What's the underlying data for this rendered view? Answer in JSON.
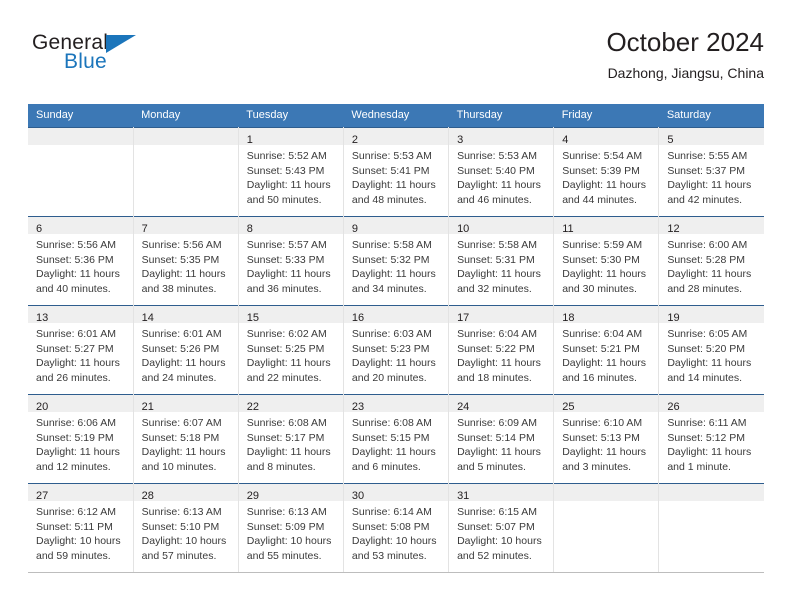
{
  "logo": {
    "word_top": "General",
    "word_bottom": "Blue",
    "accent_color": "#1b75bb",
    "triangle_icon": "triangle-right-icon"
  },
  "header": {
    "title": "October 2024",
    "subtitle": "Dazhong, Jiangsu, China"
  },
  "theme": {
    "header_blue": "#3c78b5",
    "row_divider": "#2e5d8e",
    "daynum_band": "#efefef",
    "text": "#231f20"
  },
  "calendar": {
    "weekday_headers": [
      "Sunday",
      "Monday",
      "Tuesday",
      "Wednesday",
      "Thursday",
      "Friday",
      "Saturday"
    ],
    "weeks": [
      [
        {
          "day": "",
          "lines": [
            "",
            "",
            "",
            ""
          ]
        },
        {
          "day": "",
          "lines": [
            "",
            "",
            "",
            ""
          ]
        },
        {
          "day": "1",
          "lines": [
            "Sunrise: 5:52 AM",
            "Sunset: 5:43 PM",
            "Daylight: 11 hours",
            "and 50 minutes."
          ]
        },
        {
          "day": "2",
          "lines": [
            "Sunrise: 5:53 AM",
            "Sunset: 5:41 PM",
            "Daylight: 11 hours",
            "and 48 minutes."
          ]
        },
        {
          "day": "3",
          "lines": [
            "Sunrise: 5:53 AM",
            "Sunset: 5:40 PM",
            "Daylight: 11 hours",
            "and 46 minutes."
          ]
        },
        {
          "day": "4",
          "lines": [
            "Sunrise: 5:54 AM",
            "Sunset: 5:39 PM",
            "Daylight: 11 hours",
            "and 44 minutes."
          ]
        },
        {
          "day": "5",
          "lines": [
            "Sunrise: 5:55 AM",
            "Sunset: 5:37 PM",
            "Daylight: 11 hours",
            "and 42 minutes."
          ]
        }
      ],
      [
        {
          "day": "6",
          "lines": [
            "Sunrise: 5:56 AM",
            "Sunset: 5:36 PM",
            "Daylight: 11 hours",
            "and 40 minutes."
          ]
        },
        {
          "day": "7",
          "lines": [
            "Sunrise: 5:56 AM",
            "Sunset: 5:35 PM",
            "Daylight: 11 hours",
            "and 38 minutes."
          ]
        },
        {
          "day": "8",
          "lines": [
            "Sunrise: 5:57 AM",
            "Sunset: 5:33 PM",
            "Daylight: 11 hours",
            "and 36 minutes."
          ]
        },
        {
          "day": "9",
          "lines": [
            "Sunrise: 5:58 AM",
            "Sunset: 5:32 PM",
            "Daylight: 11 hours",
            "and 34 minutes."
          ]
        },
        {
          "day": "10",
          "lines": [
            "Sunrise: 5:58 AM",
            "Sunset: 5:31 PM",
            "Daylight: 11 hours",
            "and 32 minutes."
          ]
        },
        {
          "day": "11",
          "lines": [
            "Sunrise: 5:59 AM",
            "Sunset: 5:30 PM",
            "Daylight: 11 hours",
            "and 30 minutes."
          ]
        },
        {
          "day": "12",
          "lines": [
            "Sunrise: 6:00 AM",
            "Sunset: 5:28 PM",
            "Daylight: 11 hours",
            "and 28 minutes."
          ]
        }
      ],
      [
        {
          "day": "13",
          "lines": [
            "Sunrise: 6:01 AM",
            "Sunset: 5:27 PM",
            "Daylight: 11 hours",
            "and 26 minutes."
          ]
        },
        {
          "day": "14",
          "lines": [
            "Sunrise: 6:01 AM",
            "Sunset: 5:26 PM",
            "Daylight: 11 hours",
            "and 24 minutes."
          ]
        },
        {
          "day": "15",
          "lines": [
            "Sunrise: 6:02 AM",
            "Sunset: 5:25 PM",
            "Daylight: 11 hours",
            "and 22 minutes."
          ]
        },
        {
          "day": "16",
          "lines": [
            "Sunrise: 6:03 AM",
            "Sunset: 5:23 PM",
            "Daylight: 11 hours",
            "and 20 minutes."
          ]
        },
        {
          "day": "17",
          "lines": [
            "Sunrise: 6:04 AM",
            "Sunset: 5:22 PM",
            "Daylight: 11 hours",
            "and 18 minutes."
          ]
        },
        {
          "day": "18",
          "lines": [
            "Sunrise: 6:04 AM",
            "Sunset: 5:21 PM",
            "Daylight: 11 hours",
            "and 16 minutes."
          ]
        },
        {
          "day": "19",
          "lines": [
            "Sunrise: 6:05 AM",
            "Sunset: 5:20 PM",
            "Daylight: 11 hours",
            "and 14 minutes."
          ]
        }
      ],
      [
        {
          "day": "20",
          "lines": [
            "Sunrise: 6:06 AM",
            "Sunset: 5:19 PM",
            "Daylight: 11 hours",
            "and 12 minutes."
          ]
        },
        {
          "day": "21",
          "lines": [
            "Sunrise: 6:07 AM",
            "Sunset: 5:18 PM",
            "Daylight: 11 hours",
            "and 10 minutes."
          ]
        },
        {
          "day": "22",
          "lines": [
            "Sunrise: 6:08 AM",
            "Sunset: 5:17 PM",
            "Daylight: 11 hours",
            "and 8 minutes."
          ]
        },
        {
          "day": "23",
          "lines": [
            "Sunrise: 6:08 AM",
            "Sunset: 5:15 PM",
            "Daylight: 11 hours",
            "and 6 minutes."
          ]
        },
        {
          "day": "24",
          "lines": [
            "Sunrise: 6:09 AM",
            "Sunset: 5:14 PM",
            "Daylight: 11 hours",
            "and 5 minutes."
          ]
        },
        {
          "day": "25",
          "lines": [
            "Sunrise: 6:10 AM",
            "Sunset: 5:13 PM",
            "Daylight: 11 hours",
            "and 3 minutes."
          ]
        },
        {
          "day": "26",
          "lines": [
            "Sunrise: 6:11 AM",
            "Sunset: 5:12 PM",
            "Daylight: 11 hours",
            "and 1 minute."
          ]
        }
      ],
      [
        {
          "day": "27",
          "lines": [
            "Sunrise: 6:12 AM",
            "Sunset: 5:11 PM",
            "Daylight: 10 hours",
            "and 59 minutes."
          ]
        },
        {
          "day": "28",
          "lines": [
            "Sunrise: 6:13 AM",
            "Sunset: 5:10 PM",
            "Daylight: 10 hours",
            "and 57 minutes."
          ]
        },
        {
          "day": "29",
          "lines": [
            "Sunrise: 6:13 AM",
            "Sunset: 5:09 PM",
            "Daylight: 10 hours",
            "and 55 minutes."
          ]
        },
        {
          "day": "30",
          "lines": [
            "Sunrise: 6:14 AM",
            "Sunset: 5:08 PM",
            "Daylight: 10 hours",
            "and 53 minutes."
          ]
        },
        {
          "day": "31",
          "lines": [
            "Sunrise: 6:15 AM",
            "Sunset: 5:07 PM",
            "Daylight: 10 hours",
            "and 52 minutes."
          ]
        },
        {
          "day": "",
          "lines": [
            "",
            "",
            "",
            ""
          ]
        },
        {
          "day": "",
          "lines": [
            "",
            "",
            "",
            ""
          ]
        }
      ]
    ]
  }
}
